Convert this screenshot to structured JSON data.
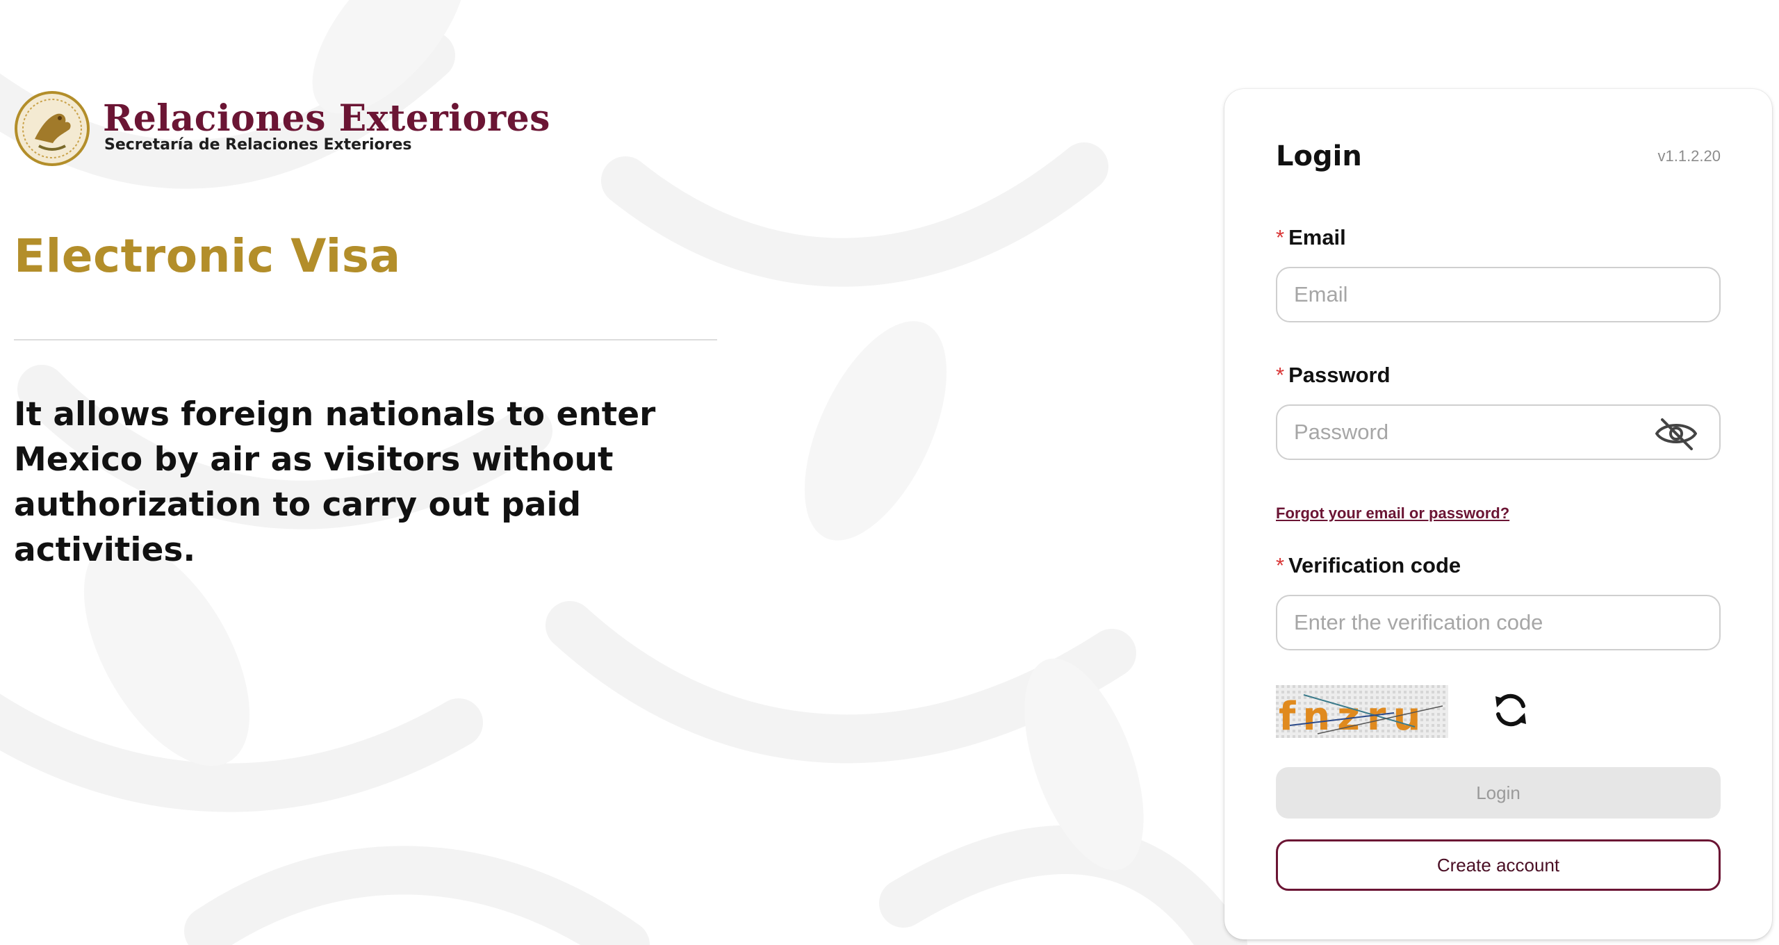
{
  "logo": {
    "title": "Relaciones Exteriores",
    "subtitle": "Secretaría de Relaciones Exteriores",
    "seal_icon": "mexico-eagle-seal"
  },
  "hero": {
    "title": "Electronic Visa",
    "description": "It allows foreign nationals to enter Mexico by air as visitors without authorization to carry out paid activities."
  },
  "login_form": {
    "title": "Login",
    "version": "v1.1.2.20",
    "required_marker": "*",
    "email": {
      "label": "Email",
      "placeholder": "Email",
      "value": ""
    },
    "password": {
      "label": "Password",
      "placeholder": "Password",
      "value": "",
      "toggle_icon": "eye-slash-icon"
    },
    "forgot_link": "Forgot your email or password?",
    "verification": {
      "label": "Verification code",
      "placeholder": "Enter the verification code",
      "value": ""
    },
    "captcha_text": "fnzru",
    "refresh_icon": "refresh-icon",
    "login_button": "Login",
    "create_account_button": "Create account"
  },
  "colors": {
    "brand_maroon": "#6b1534",
    "gold": "#b38e2a",
    "required_red": "#d93636",
    "disabled_bg": "#e6e6e6"
  }
}
